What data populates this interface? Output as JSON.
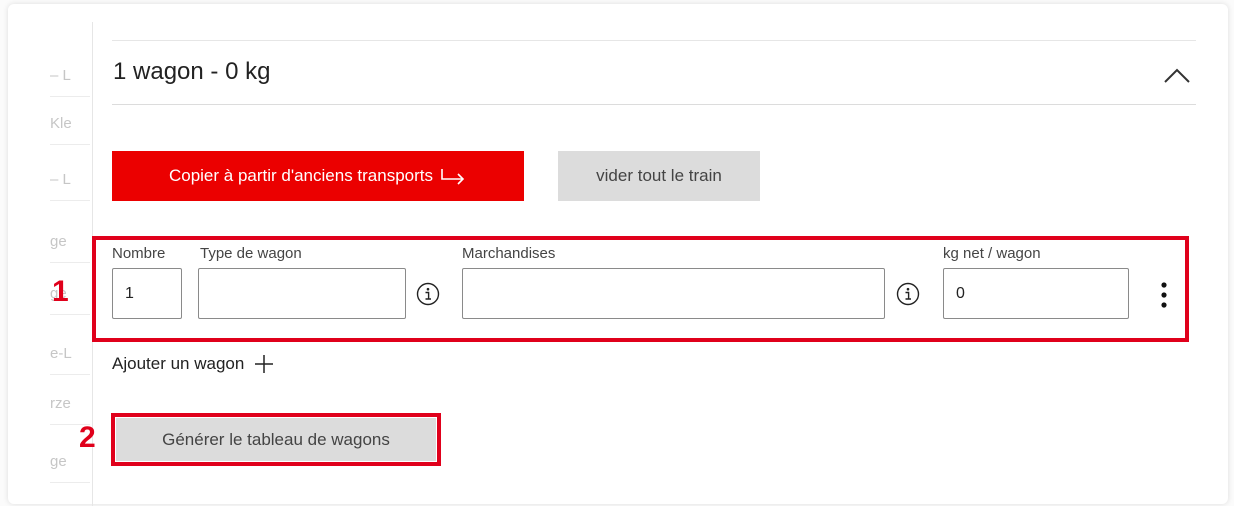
{
  "header": {
    "title": "1 wagon - 0 kg",
    "collapse_icon": "chevron-up-icon"
  },
  "left_fragments": [
    "– L",
    "Kle",
    "– L",
    "ge",
    "ge",
    "e-L",
    "rze",
    "ge"
  ],
  "buttons": {
    "copy_label": "Copier à partir d'anciens transports",
    "copy_icon": "arrow-return-right-icon",
    "clear_label": "vider tout le train",
    "generate_label": "Générer le tableau de wagons"
  },
  "wagon_row": {
    "count_label": "Nombre",
    "count_value": "1",
    "type_label": "Type de wagon",
    "type_value": "",
    "goods_label": "Marchandises",
    "goods_value": "",
    "weight_label": "kg net / wagon",
    "weight_value": "0",
    "info_icon": "info-icon",
    "menu_icon": "kebab-menu-icon"
  },
  "add_wagon": {
    "label": "Ajouter un wagon",
    "icon": "plus-icon"
  },
  "annotations": [
    {
      "number": "1"
    },
    {
      "number": "2"
    }
  ],
  "colors": {
    "primary_red": "#eb0000",
    "annotation_red": "#e0001b",
    "secondary_grey": "#dcdcdc"
  }
}
